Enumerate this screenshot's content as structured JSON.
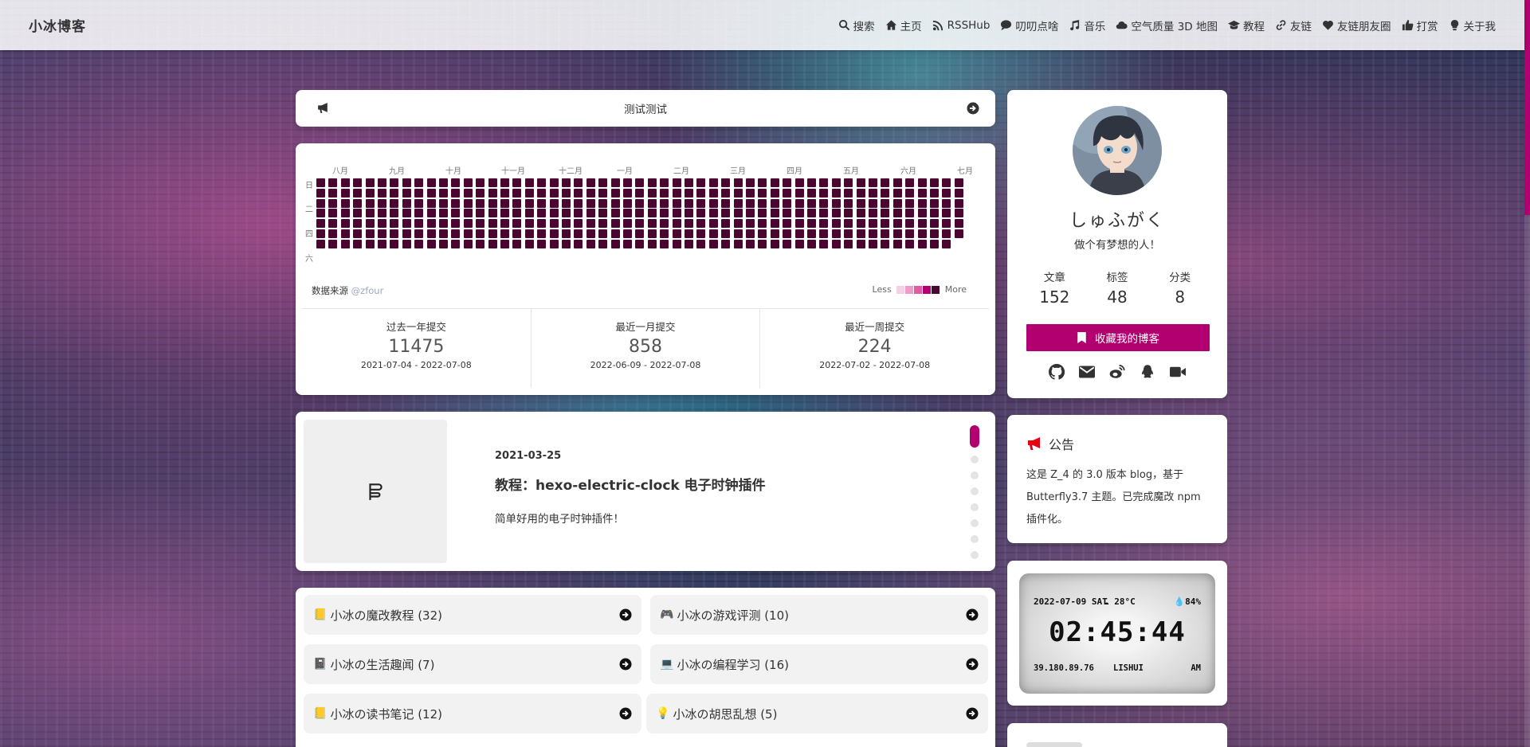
{
  "site": {
    "name": "小冰博客"
  },
  "nav": {
    "items": [
      {
        "label": "搜索",
        "icon": "search-icon"
      },
      {
        "label": "主页",
        "icon": "home-icon"
      },
      {
        "label": "RSSHub",
        "icon": "rss-icon"
      },
      {
        "label": "叨叨点啥",
        "icon": "comment-icon"
      },
      {
        "label": "音乐",
        "icon": "music-icon"
      },
      {
        "label": "空气质量 3D 地图",
        "icon": "cloud-icon"
      },
      {
        "label": "教程",
        "icon": "graduation-cap-icon"
      },
      {
        "label": "友链",
        "icon": "link-icon"
      },
      {
        "label": "友链朋友圈",
        "icon": "heart-icon"
      },
      {
        "label": "打赏",
        "icon": "thumbs-up-icon"
      },
      {
        "label": "关于我",
        "icon": "lightbulb-icon"
      }
    ]
  },
  "notice": {
    "text": "测试测试"
  },
  "contributions": {
    "months": [
      "八月",
      "九月",
      "十月",
      "十一月",
      "十二月",
      "一月",
      "二月",
      "三月",
      "四月",
      "五月",
      "六月",
      "七月"
    ],
    "weekdays": [
      "日",
      "二",
      "四",
      "六"
    ],
    "source_label": "数据来源",
    "source_handle": "@zfour",
    "legend_less": "Less",
    "legend_more": "More",
    "legend_colors": [
      "#f5d0e6",
      "#f09ccb",
      "#e05aa6",
      "#b30070",
      "#4a0530"
    ],
    "cell_color": "#4a0530",
    "stats": [
      {
        "label": "过去一年提交",
        "value": "11475",
        "range": "2021-07-04 - 2022-07-08"
      },
      {
        "label": "最近一月提交",
        "value": "858",
        "range": "2022-06-09 - 2022-07-08"
      },
      {
        "label": "最近一周提交",
        "value": "224",
        "range": "2022-07-02 - 2022-07-08"
      }
    ]
  },
  "post": {
    "date": "2021-03-25",
    "title": "教程：hexo-electric-clock 电子时钟插件",
    "description": "简单好用的电子时钟插件！",
    "thumbnail_icon": "flickr-style-icon"
  },
  "categories": [
    {
      "label": "小冰の魔改教程 (32)",
      "emoji": "📒"
    },
    {
      "label": "小冰の游戏评测 (10)",
      "emoji": "🎮"
    },
    {
      "label": "小冰の生活趣闻 (7)",
      "emoji": "📓"
    },
    {
      "label": "小冰の编程学习 (16)",
      "emoji": "💻"
    },
    {
      "label": "小冰の读书笔记 (12)",
      "emoji": "📒"
    },
    {
      "label": "小冰の胡思乱想 (5)",
      "emoji": "💡"
    }
  ],
  "author": {
    "name": "しゅふがく",
    "description": "做个有梦想的人！",
    "site_data": [
      {
        "label": "文章",
        "value": "152"
      },
      {
        "label": "标签",
        "value": "48"
      },
      {
        "label": "分类",
        "value": "8"
      }
    ],
    "bookmark_label": "收藏我的博客",
    "socials": [
      "github-icon",
      "envelope-icon",
      "weibo-icon",
      "qq-icon",
      "video-icon"
    ]
  },
  "announcement": {
    "title": "公告",
    "body": "这是 Z_4 的 3.0 版本 blog，基于 Butterfly3.7 主题。已完成魔改 npm 插件化。"
  },
  "clock": {
    "date": "2022-07-09 SAT",
    "weather": "☁ 28°C",
    "humidity": "💧84%",
    "time": "02:45:44",
    "ip": "39.180.89.76",
    "city": "LISHUI",
    "ampm": "AM"
  },
  "colors": {
    "accent": "#b30070"
  }
}
